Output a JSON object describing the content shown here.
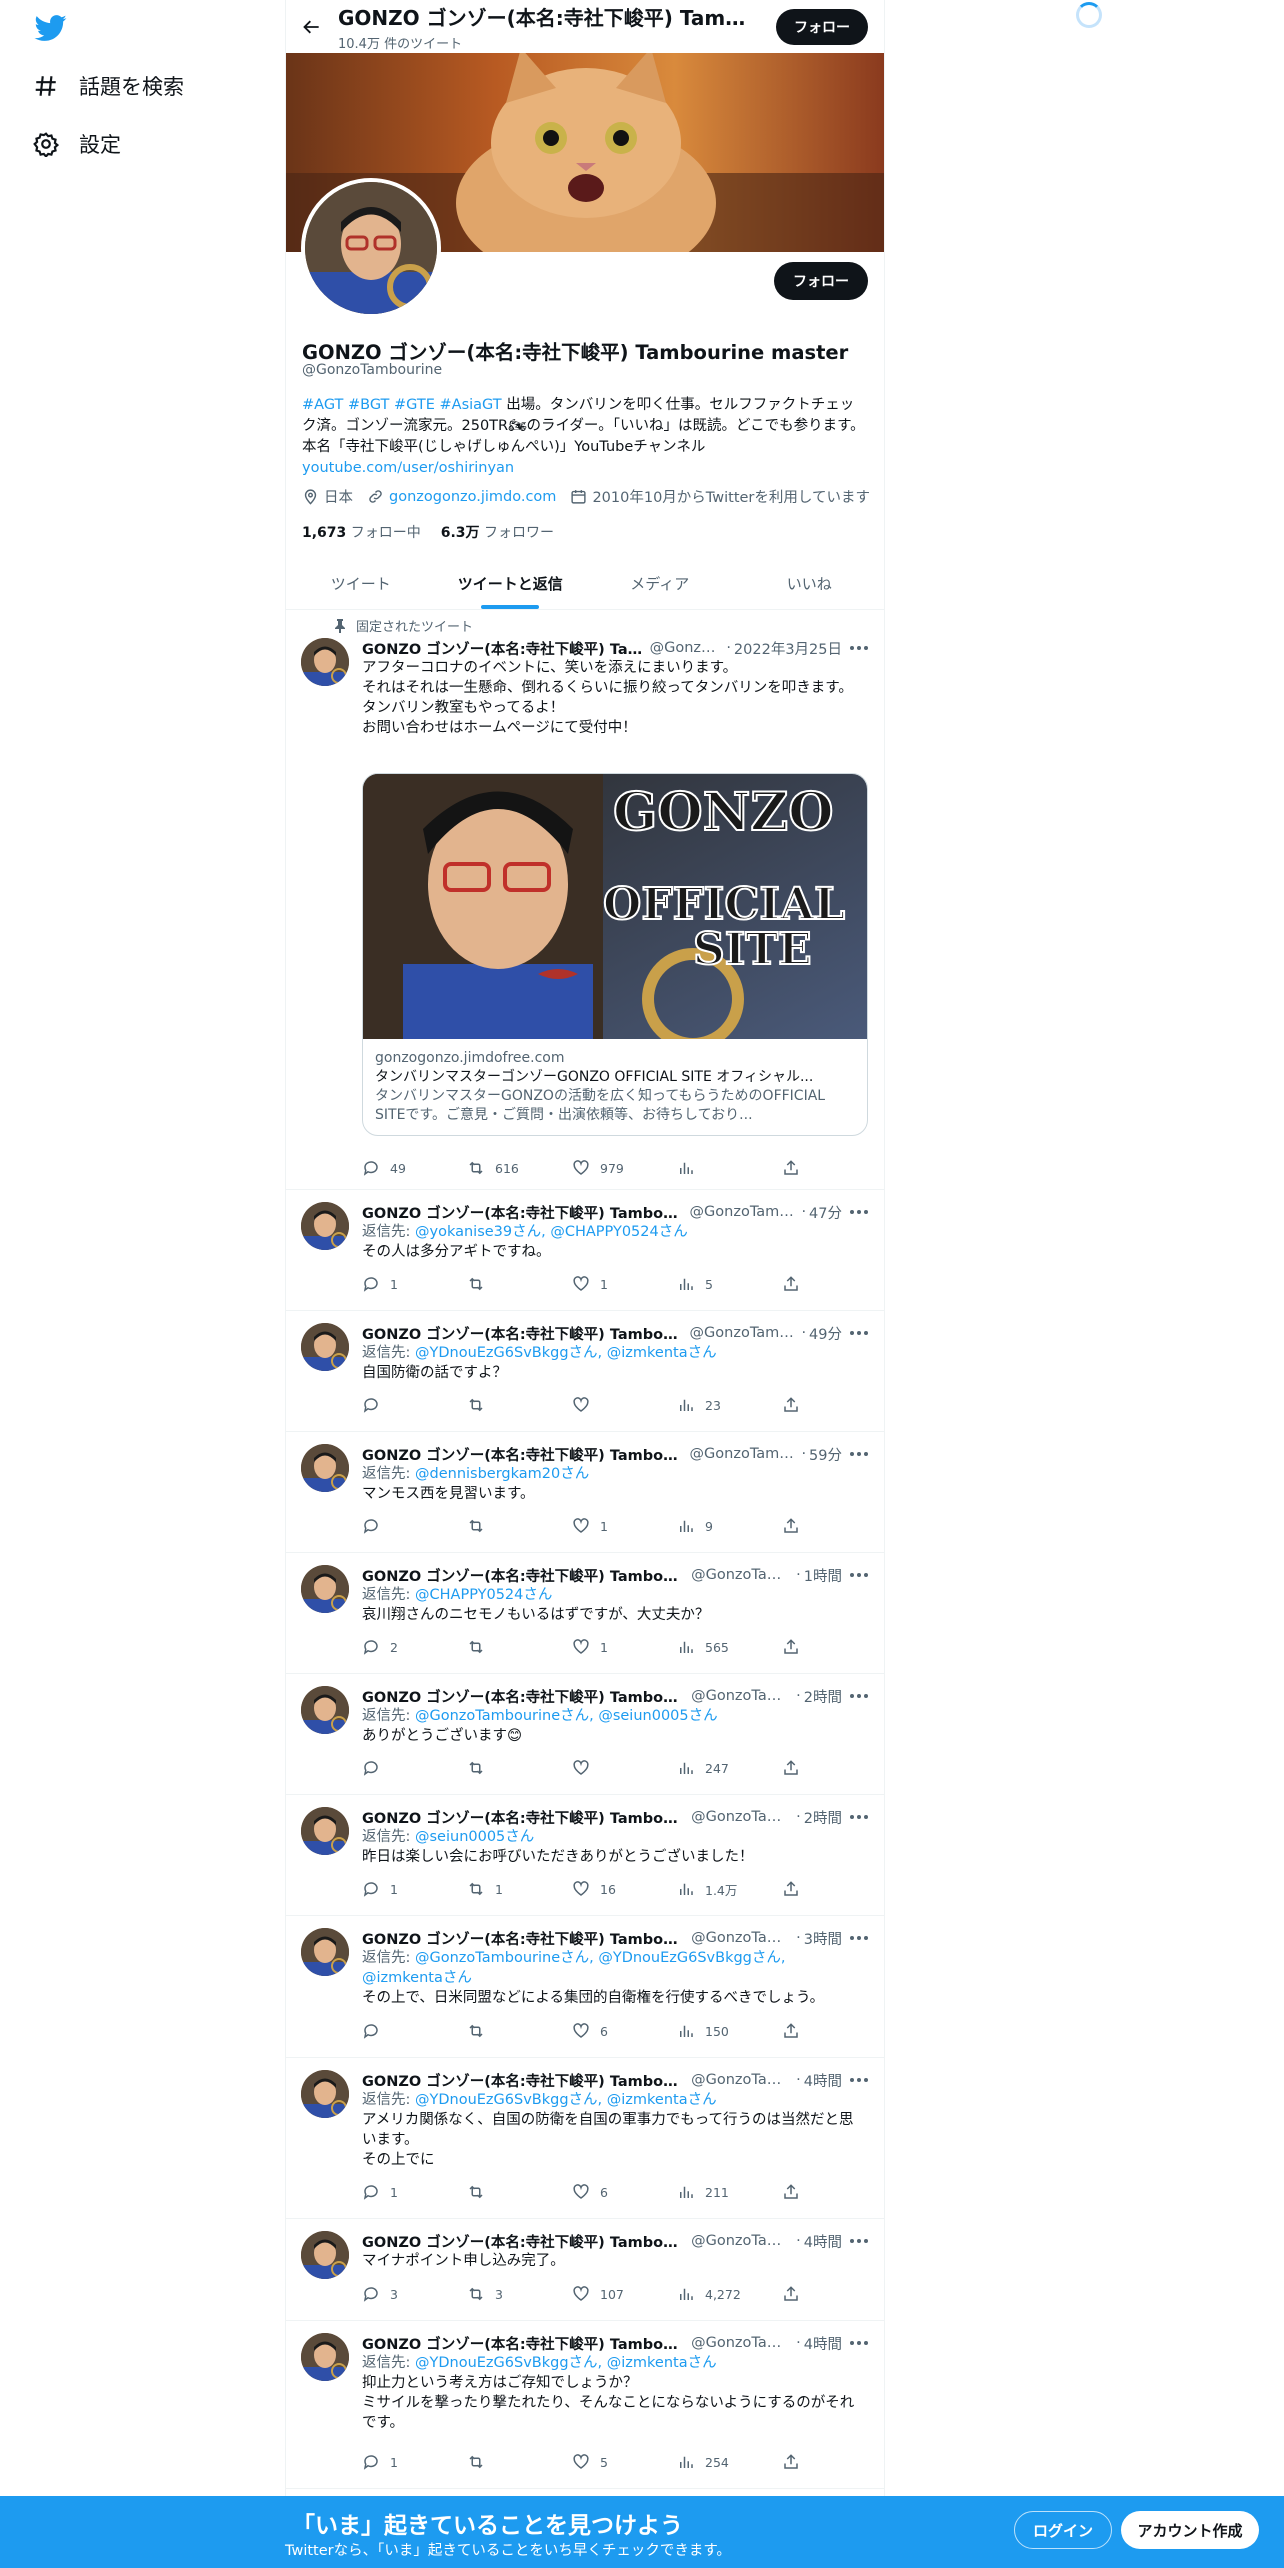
{
  "nav": {
    "explore_label": "話題を検索",
    "settings_label": "設定"
  },
  "header": {
    "name": "GONZO ゴンゾー(本名:寺社下峻平) Tambourine master",
    "tweet_count": "10.4万 件のツイート",
    "follow_label": "フォロー"
  },
  "profile": {
    "name": "GONZO ゴンゾー(本名:寺社下峻平) Tambourine master",
    "handle": "@GonzoTambourine",
    "follow_label": "フォロー",
    "bio_tags": "#AGT #BGT #GTE #AsiaGT",
    "bio_text": " 出場。タンバリンを叩く仕事。セルフファクトチェック済。ゴンゾー流家元。250TR🏍のライダー。「いいね」は既読。どこでも参ります。本名「寺社下峻平(じしゃげしゅんぺい)」YouTubeチャンネル",
    "bio_link": "youtube.com/user/oshirinyan",
    "location": "日本",
    "website": "gonzogonzo.jimdo.com",
    "joined": "2010年10月からTwitterを利用しています",
    "following_count": "1,673",
    "following_label": "フォロー中",
    "followers_count": "6.3万",
    "followers_label": "フォロワー"
  },
  "tabs": [
    {
      "label": "ツイート"
    },
    {
      "label": "ツイートと返信"
    },
    {
      "label": "メディア"
    },
    {
      "label": "いいね"
    }
  ],
  "pinned_label": "固定されたツイート",
  "pinned_tweet": {
    "name": "GONZO ゴンゾー(本名:寺社下峻平) Ta...",
    "handle": "@Gonzo...",
    "time": "2022年3月25日",
    "text": "アフターコロナのイベントに、笑いを添えにまいります。\nそれはそれは一生懸命、倒れるくらいに振り絞ってタンバリンを叩きます。\nタンバリン教室もやってるよ！\nお問い合わせはホームページにて受付中！",
    "card_overlay_1": "GONZO",
    "card_overlay_2": "OFFICIAL",
    "card_overlay_3": "SITE",
    "card_domain": "gonzogonzo.jimdofree.com",
    "card_title": "タンバリンマスターゴンゾーGONZO OFFICIAL SITE オフィシャル...",
    "card_desc": "タンバリンマスターGONZOの活動を広く知ってもらうためのOFFICIAL SITEです。ご意見・ご質問・出演依頼等、お待ちしており...",
    "replies": "49",
    "retweets": "616",
    "likes": "979",
    "views": ""
  },
  "tweets": [
    {
      "name": "GONZO ゴンゾー(本名:寺社下峻平) Tambour...",
      "handle": "@GonzoTamb...",
      "time": "47分",
      "reply_prefix": "返信先: ",
      "reply_to": "@yokanise39さん, @CHAPPY0524さん",
      "text": "その人は多分アギトですね。",
      "replies": "1",
      "retweets": "",
      "likes": "1",
      "views": "5"
    },
    {
      "name": "GONZO ゴンゾー(本名:寺社下峻平) Tambour...",
      "handle": "@GonzoTamb...",
      "time": "49分",
      "reply_prefix": "返信先: ",
      "reply_to": "@YDnouEzG6SvBkggさん, @izmkentaさん",
      "text": "自国防衛の話ですよ？",
      "replies": "",
      "retweets": "",
      "likes": "",
      "views": "23"
    },
    {
      "name": "GONZO ゴンゾー(本名:寺社下峻平) Tambour...",
      "handle": "@GonzoTamb...",
      "time": "59分",
      "reply_prefix": "返信先: ",
      "reply_to": "@dennisbergkam20さん",
      "text": "マンモス西を見習います。",
      "replies": "",
      "retweets": "",
      "likes": "1",
      "views": "9"
    },
    {
      "name": "GONZO ゴンゾー(本名:寺社下峻平) Tambou...",
      "handle": "@GonzoTam...",
      "time": "1時間",
      "reply_prefix": "返信先: ",
      "reply_to": "@CHAPPY0524さん",
      "text": "哀川翔さんのニセモノもいるはずですが、大丈夫か？",
      "replies": "2",
      "retweets": "",
      "likes": "1",
      "views": "565"
    },
    {
      "name": "GONZO ゴンゾー(本名:寺社下峻平) Tambou...",
      "handle": "@GonzoTam...",
      "time": "2時間",
      "reply_prefix": "返信先: ",
      "reply_to": "@GonzoTambourineさん, @seiun0005さん",
      "text": "ありがとうございます😊",
      "replies": "",
      "retweets": "",
      "likes": "",
      "views": "247"
    },
    {
      "name": "GONZO ゴンゾー(本名:寺社下峻平) Tambou...",
      "handle": "@GonzoTam...",
      "time": "2時間",
      "reply_prefix": "返信先: ",
      "reply_to": "@seiun0005さん",
      "text": "昨日は楽しい会にお呼びいただきありがとうございました！",
      "replies": "1",
      "retweets": "1",
      "likes": "16",
      "views": "1.4万"
    },
    {
      "name": "GONZO ゴンゾー(本名:寺社下峻平) Tambou...",
      "handle": "@GonzoTam...",
      "time": "3時間",
      "reply_prefix": "返信先: ",
      "reply_to": "@GonzoTambourineさん, @YDnouEzG6SvBkggさん, @izmkentaさん",
      "text": "その上で、日米同盟などによる集団的自衛権を行使するべきでしょう。",
      "replies": "",
      "retweets": "",
      "likes": "6",
      "views": "150"
    },
    {
      "name": "GONZO ゴンゾー(本名:寺社下峻平) Tambou...",
      "handle": "@GonzoTam...",
      "time": "4時間",
      "reply_prefix": "返信先: ",
      "reply_to": "@YDnouEzG6SvBkggさん, @izmkentaさん",
      "text": "アメリカ関係なく、自国の防衛を自国の軍事力でもって行うのは当然だと思います。\nその上でに",
      "replies": "1",
      "retweets": "",
      "likes": "6",
      "views": "211"
    },
    {
      "name": "GONZO ゴンゾー(本名:寺社下峻平) Tambou...",
      "handle": "@GonzoTam...",
      "time": "4時間",
      "reply_prefix": "",
      "reply_to": "",
      "text": "マイナポイント申し込み完了。",
      "replies": "3",
      "retweets": "3",
      "likes": "107",
      "views": "4,272"
    },
    {
      "name": "GONZO ゴンゾー(本名:寺社下峻平) Tambou...",
      "handle": "@GonzoTam...",
      "time": "4時間",
      "reply_prefix": "返信先: ",
      "reply_to": "@YDnouEzG6SvBkggさん, @izmkentaさん",
      "text": "抑止力という考え方はご存知でしょうか？\nミサイルを撃ったり撃たれたり、そんなことにならないようにするのがそれです。",
      "replies": "1",
      "retweets": "",
      "likes": "5",
      "views": "254"
    }
  ],
  "bottom": {
    "title": "「いま」起きていることを見つけよう",
    "subtitle": "Twitterなら、「いま」起きていることをいち早くチェックできます。",
    "login_label": "ログイン",
    "signup_label": "アカウント作成"
  },
  "colors": {
    "accent": "#1d9bf0",
    "text": "#0f1419",
    "muted": "#536471"
  }
}
